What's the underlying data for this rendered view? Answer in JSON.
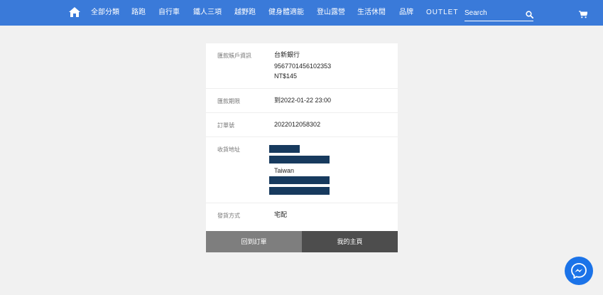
{
  "nav": {
    "items": [
      "全部分類",
      "路跑",
      "自行車",
      "鐵人三項",
      "越野跑",
      "健身體適能",
      "登山露營",
      "生活休閒",
      "品牌",
      "OUTLET"
    ],
    "search_placeholder": "Search"
  },
  "payment": {
    "account_label": "匯款賬戶資訊",
    "bank_name": "台新銀行",
    "account_number": "9567701456102353",
    "amount": "NT$145",
    "deadline_label": "匯款期限",
    "deadline": "到2022-01-22 23:00",
    "order_label": "訂單號",
    "order_number": "2022012058302",
    "address_label": "收貨地址",
    "address_country": "Taiwan",
    "shipping_label": "發貨方式",
    "shipping_method": "宅配"
  },
  "buttons": {
    "back_to_orders": "回到訂單",
    "my_home": "我的主頁"
  },
  "colors": {
    "navbar": "#3a7ad9",
    "redaction": "#173a5e",
    "back_button": "#7e7e7e",
    "home_button": "#4d4d4d",
    "messenger": "#1b73e8"
  },
  "icons": {
    "home": "home-icon",
    "search": "search-icon",
    "cart": "cart-icon",
    "messenger": "messenger-icon"
  }
}
